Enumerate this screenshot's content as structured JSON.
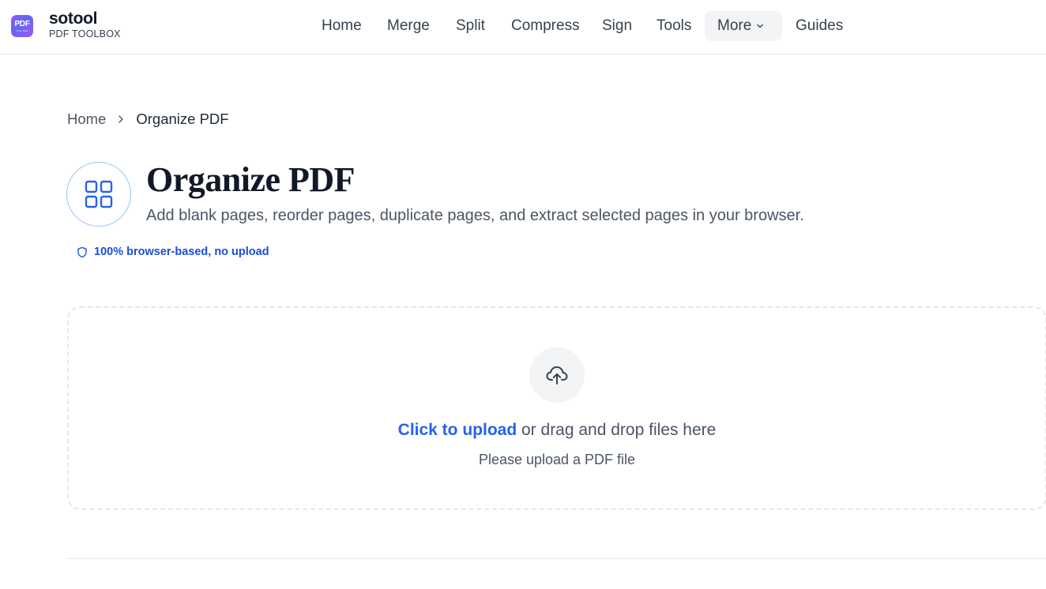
{
  "brand": {
    "logo_text": "PDF",
    "logo_subtext": "Free Tools",
    "name": "sotool",
    "subtitle": "PDF TOOLBOX"
  },
  "nav": {
    "home": "Home",
    "merge": "Merge",
    "split": "Split",
    "compress": "Compress",
    "sign": "Sign",
    "tools": "Tools",
    "more": "More",
    "guides": "Guides"
  },
  "breadcrumb": {
    "home": "Home",
    "current": "Organize PDF"
  },
  "page": {
    "title": "Organize PDF",
    "description": "Add blank pages, reorder pages, duplicate pages, and extract selected pages in your browser.",
    "badge": "100% browser-based, no upload"
  },
  "upload": {
    "link_text": "Click to upload",
    "rest_text": " or drag and drop files here",
    "hint": "Please upload a PDF file"
  },
  "colors": {
    "accent": "#2563eb",
    "badge": "#1d4ed8",
    "icon_ring": "#93c5fd",
    "nav_more_bg": "#f3f4f6"
  },
  "icons": {
    "logo": "pdf-logo-icon",
    "more": "chevron-down-icon",
    "breadcrumb_sep": "chevron-right-icon",
    "tool": "grid-icon",
    "badge": "shield-icon",
    "upload": "cloud-upload-icon"
  }
}
